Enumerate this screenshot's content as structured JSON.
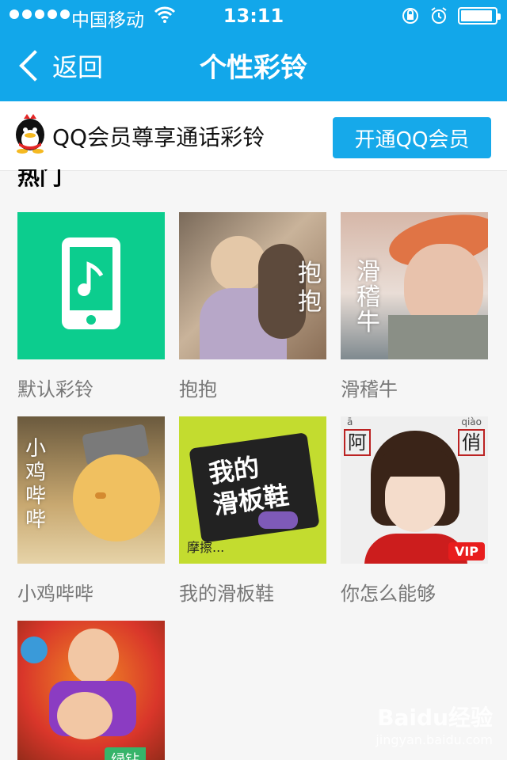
{
  "status_bar": {
    "carrier": "中国移动",
    "time": "13:11",
    "battery_level": 0.92
  },
  "nav": {
    "back_label": "返回",
    "title": "个性彩铃"
  },
  "member": {
    "text": "QQ会员尊享通话彩铃",
    "button_label": "开通QQ会员"
  },
  "section": {
    "title": "热门"
  },
  "tiles": [
    {
      "name": "默认彩铃"
    },
    {
      "name": "抱抱",
      "overlay": "抱\n抱"
    },
    {
      "name": "滑稽牛",
      "overlay": "滑\n稽\n牛"
    },
    {
      "name": "小鸡哔哔",
      "overlay": "小\n鸡\n哔\n哔"
    },
    {
      "name": "我的滑板鞋",
      "overlay": "我的\n滑板鞋",
      "overlay_small": "摩擦..."
    },
    {
      "name": "你怎么能够",
      "overlay_left": "阿",
      "overlay_left_pinyin": "ā",
      "overlay_right": "俏",
      "overlay_right_pinyin": "qiào",
      "badge": "VIP"
    },
    {
      "name": "",
      "badge": "绿钻"
    }
  ],
  "watermark": {
    "brand": "Baidu经验",
    "url": "jingyan.baidu.com"
  },
  "colors": {
    "topbar": "#12a7ea",
    "button": "#16a9ea",
    "default_tile": "#0ccd8e",
    "vip_badge": "#e81d1d",
    "green_badge": "#36b46a"
  },
  "icons": [
    "wifi-icon",
    "rotation-lock-icon",
    "alarm-icon",
    "battery-icon",
    "back-chevron-icon",
    "qq-penguin-icon",
    "phone-music-icon"
  ]
}
